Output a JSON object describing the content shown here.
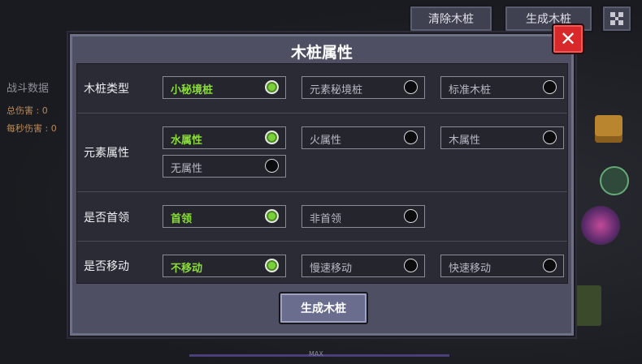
{
  "top_bar": {
    "clear_label": "清除木桩",
    "generate_label": "生成木桩"
  },
  "stats": {
    "title": "战斗数据",
    "total_damage": "总伤害 : 0",
    "dps": "每秒伤害 : 0"
  },
  "panel": {
    "title": "木桩属性",
    "close": "✕",
    "rows": [
      {
        "label": "木桩类型",
        "options": [
          {
            "text": "小秘境桩",
            "selected": true
          },
          {
            "text": "元素秘境桩",
            "selected": false
          },
          {
            "text": "标准木桩",
            "selected": false
          }
        ]
      },
      {
        "label": "元素属性",
        "options": [
          {
            "text": "水属性",
            "selected": true
          },
          {
            "text": "火属性",
            "selected": false
          },
          {
            "text": "木属性",
            "selected": false
          },
          {
            "text": "无属性",
            "selected": false
          }
        ]
      },
      {
        "label": "是否首领",
        "options": [
          {
            "text": "首领",
            "selected": true
          },
          {
            "text": "非首领",
            "selected": false
          }
        ]
      },
      {
        "label": "是否移动",
        "options": [
          {
            "text": "不移动",
            "selected": true
          },
          {
            "text": "慢速移动",
            "selected": false
          },
          {
            "text": "快速移动",
            "selected": false
          }
        ]
      }
    ],
    "generate_label": "生成木桩"
  },
  "footer": {
    "max_label": "MAX"
  },
  "colors": {
    "selected_text": "#8bdc3c",
    "close_red": "#d8282a",
    "panel_bg": "#4e4f63"
  }
}
